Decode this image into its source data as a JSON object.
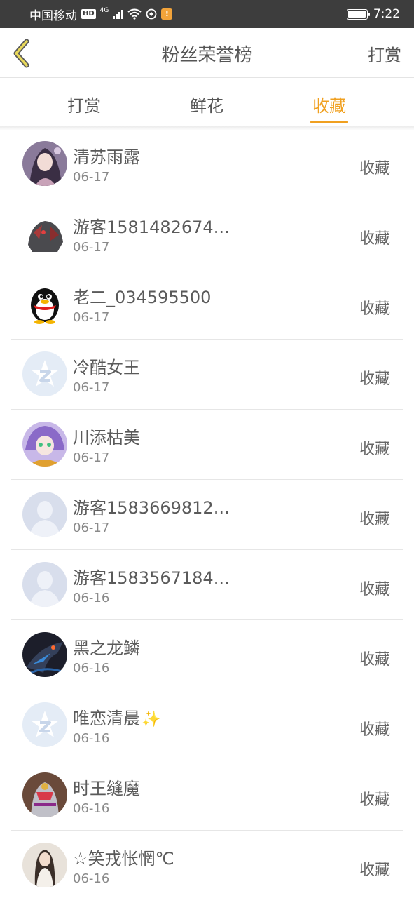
{
  "status_bar": {
    "carrier": "中国移动",
    "hd": "HD",
    "network": "4G",
    "notification": "!",
    "time": "7:22",
    "battery_level": 1.0
  },
  "header": {
    "title": "粉丝荣誉榜",
    "action": "打赏",
    "back_icon": "chevron-left-icon"
  },
  "tabs": [
    {
      "label": "打赏",
      "active": false
    },
    {
      "label": "鲜花",
      "active": false
    },
    {
      "label": "收藏",
      "active": true
    }
  ],
  "colors": {
    "accent": "#f0a020",
    "back_icon": "#e8d85a"
  },
  "list": [
    {
      "name": "清苏雨露",
      "date": "06-17",
      "action": "收藏",
      "avatar": "anime-girl-avatar"
    },
    {
      "name": "游客1581482674...",
      "date": "06-17",
      "action": "收藏",
      "avatar": "monster-avatar"
    },
    {
      "name": "老二_034595500",
      "date": "06-17",
      "action": "收藏",
      "avatar": "qq-penguin-avatar"
    },
    {
      "name": "冷酷女王",
      "date": "06-17",
      "action": "收藏",
      "avatar": "default-z-avatar"
    },
    {
      "name": "川添枯美",
      "date": "06-17",
      "action": "收藏",
      "avatar": "anime-character-avatar"
    },
    {
      "name": "游客1583669812...",
      "date": "06-17",
      "action": "收藏",
      "avatar": "default-person-avatar"
    },
    {
      "name": "游客1583567184...",
      "date": "06-16",
      "action": "收藏",
      "avatar": "default-person-avatar"
    },
    {
      "name": "黑之龙鳞",
      "date": "06-16",
      "action": "收藏",
      "avatar": "dark-dragon-avatar"
    },
    {
      "name": "唯恋清晨",
      "date": "06-16",
      "action": "收藏",
      "avatar": "default-z-avatar",
      "emoji": "✨"
    },
    {
      "name": "时王缝魔",
      "date": "06-16",
      "action": "收藏",
      "avatar": "rider-avatar"
    },
    {
      "name": "☆笑戎怅惘℃",
      "date": "06-16",
      "action": "收藏",
      "avatar": "photo-girl-avatar"
    }
  ]
}
